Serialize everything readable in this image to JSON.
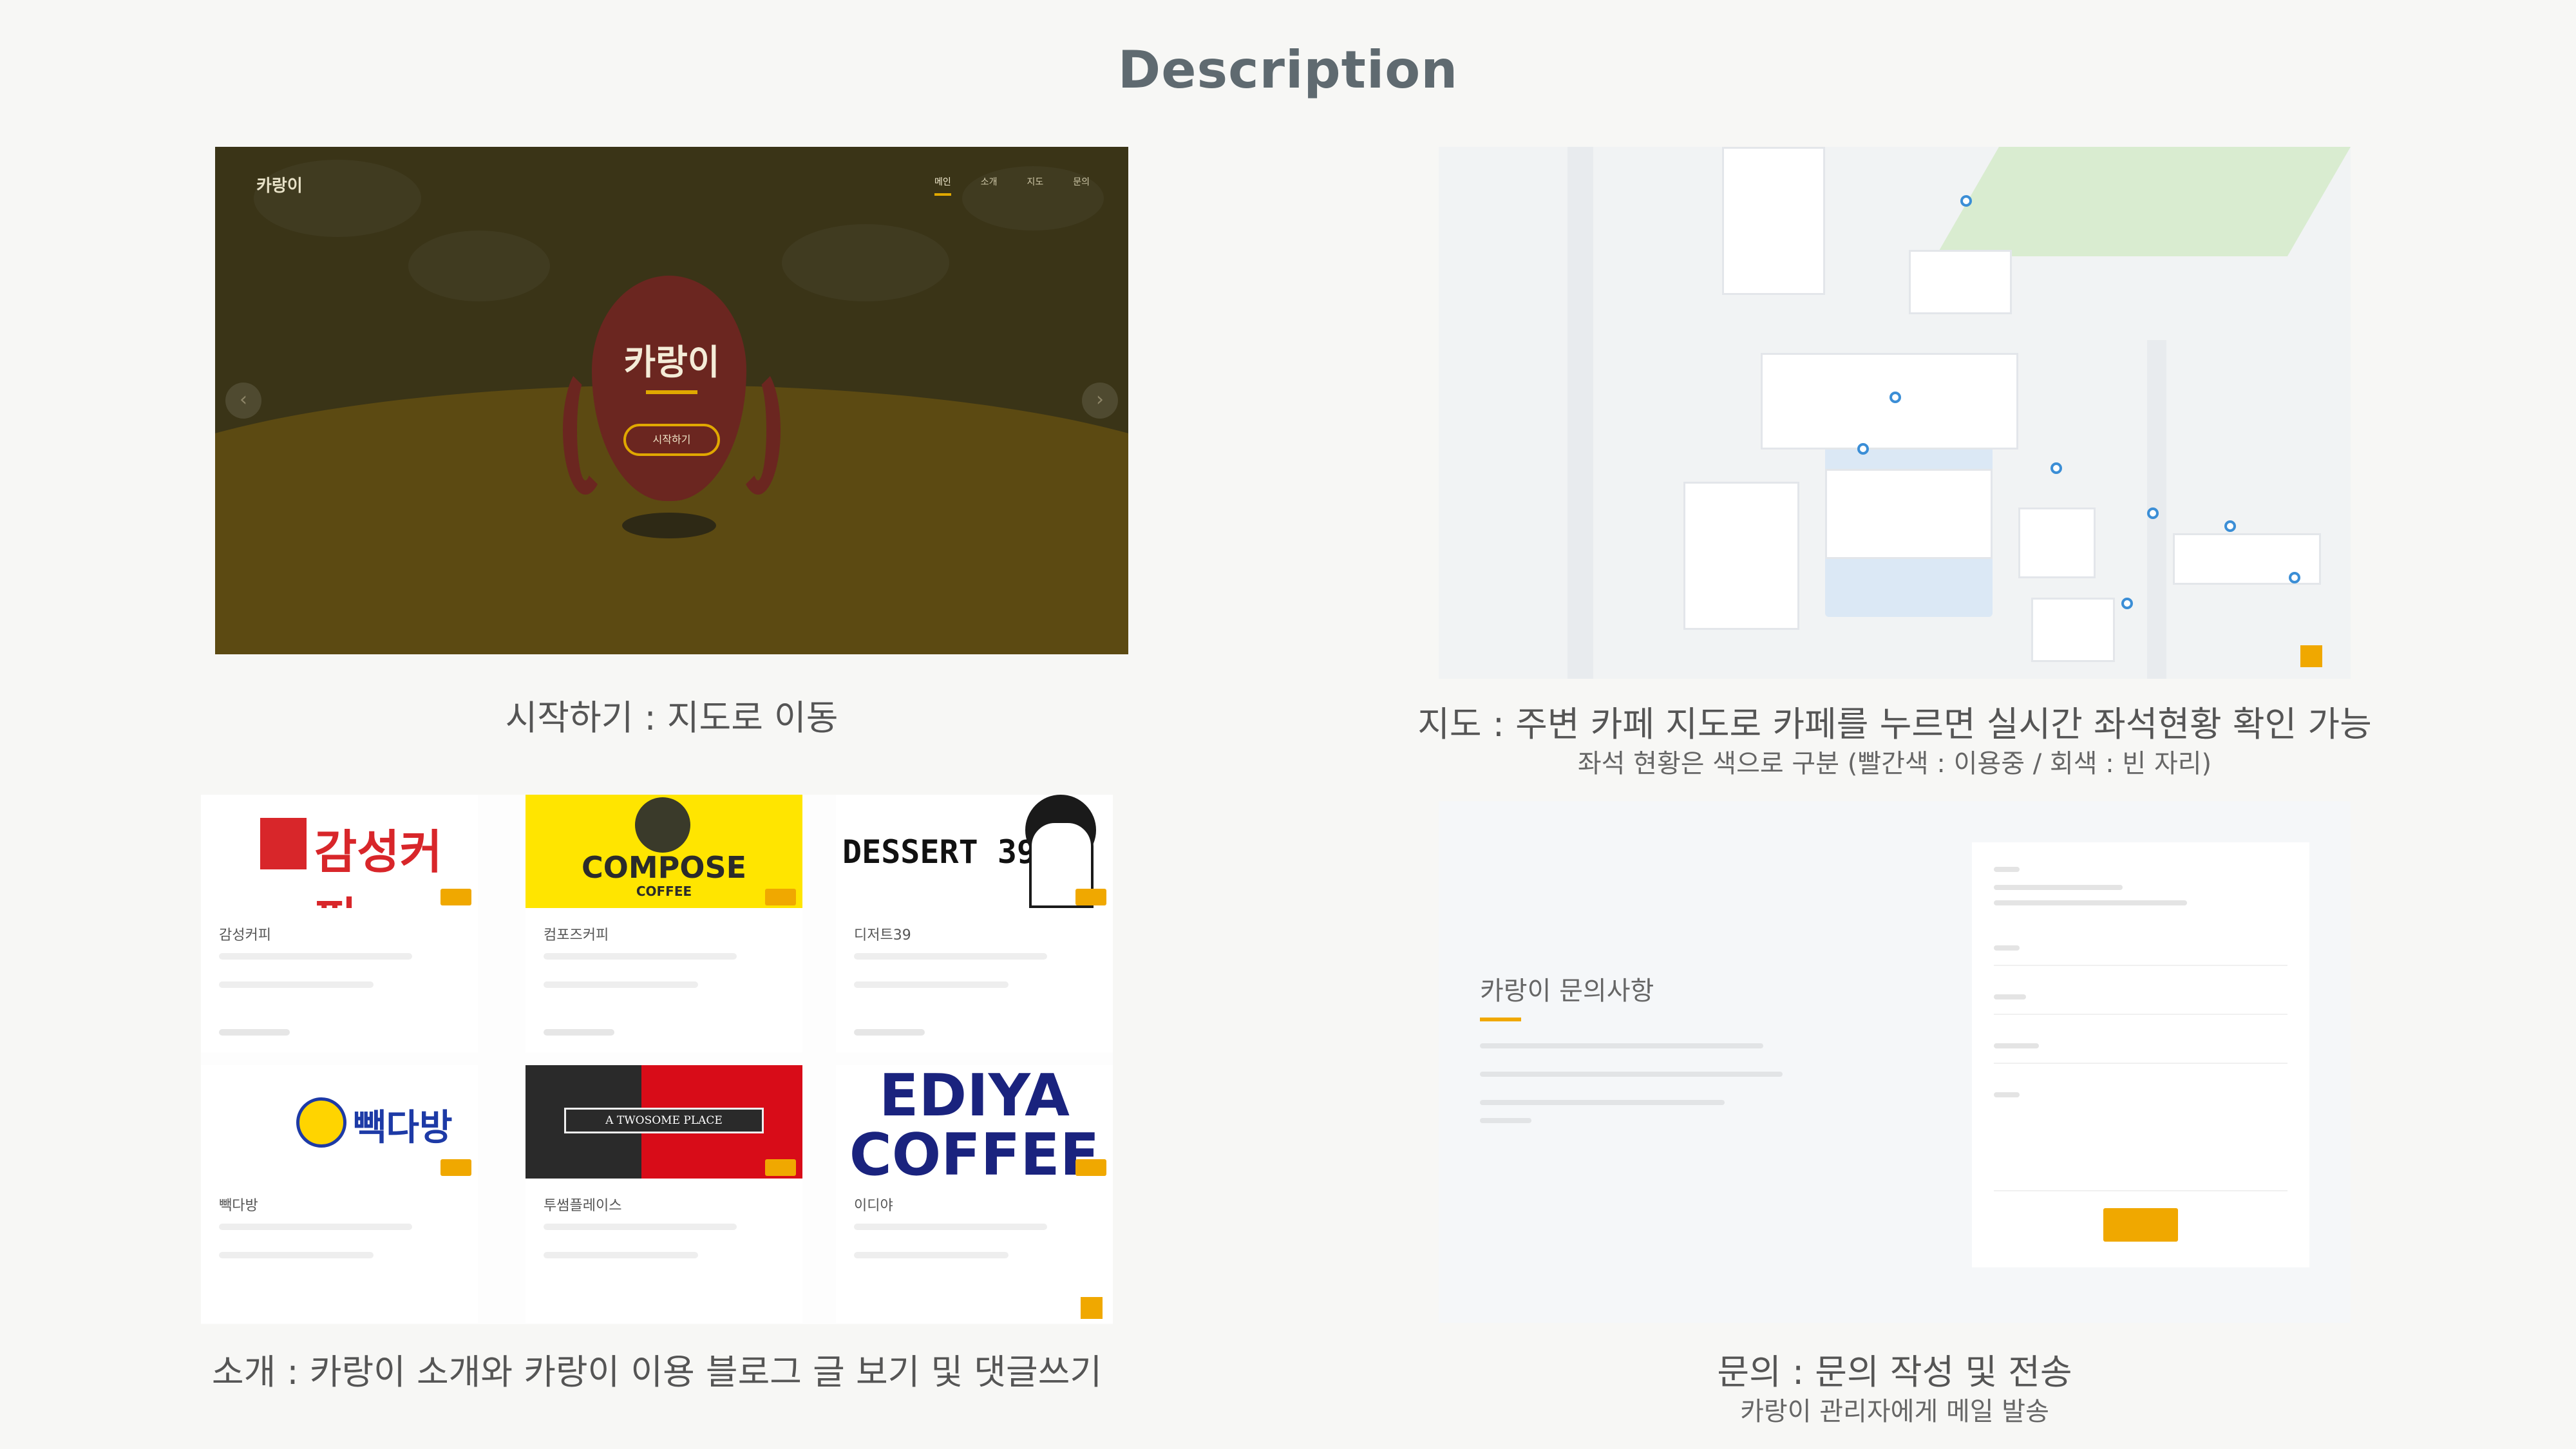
{
  "page": {
    "title": "Description"
  },
  "start_panel": {
    "brand": "카랑이",
    "nav_items": [
      "메인",
      "소개",
      "지도",
      "문의"
    ],
    "logo_text": "카랑이",
    "start_button": "시작하기",
    "prev_icon": "chevron-left-icon",
    "next_icon": "chevron-right-icon",
    "caption": "시작하기 : 지도로 이동"
  },
  "map_panel": {
    "caption": "지도 : 주변 카페 지도로 카페를 누르면 실시간 좌석현황 확인 가능",
    "subcaption": "좌석 현황은 색으로 구분 (빨간색 : 이용중 / 회색 : 빈 자리)"
  },
  "cafe_panel": {
    "cafes": [
      {
        "name": "감성커피",
        "logo": "감성커피"
      },
      {
        "name": "컴포즈커피",
        "logo": "COMPOSE",
        "logo_sub": "COFFEE"
      },
      {
        "name": "디저트39",
        "logo": "DESSERT 39"
      },
      {
        "name": "빽다방",
        "logo": "빽다방"
      },
      {
        "name": "투썸플레이스",
        "logo": "A TWOSOME PLACE"
      },
      {
        "name": "이디야",
        "logo": "EDIYA",
        "logo_sub": "COFFEE"
      }
    ],
    "caption": "소개 : 카랑이 소개와 카랑이 이용 블로그 글 보기 및 댓글쓰기"
  },
  "inquiry_panel": {
    "title": "카랑이 문의사항",
    "caption": "문의 : 문의 작성 및 전송",
    "subcaption": "카랑이 관리자에게 메일 발송"
  },
  "colors": {
    "accent": "#f0a800",
    "map_pin": "#3b8ed6"
  }
}
